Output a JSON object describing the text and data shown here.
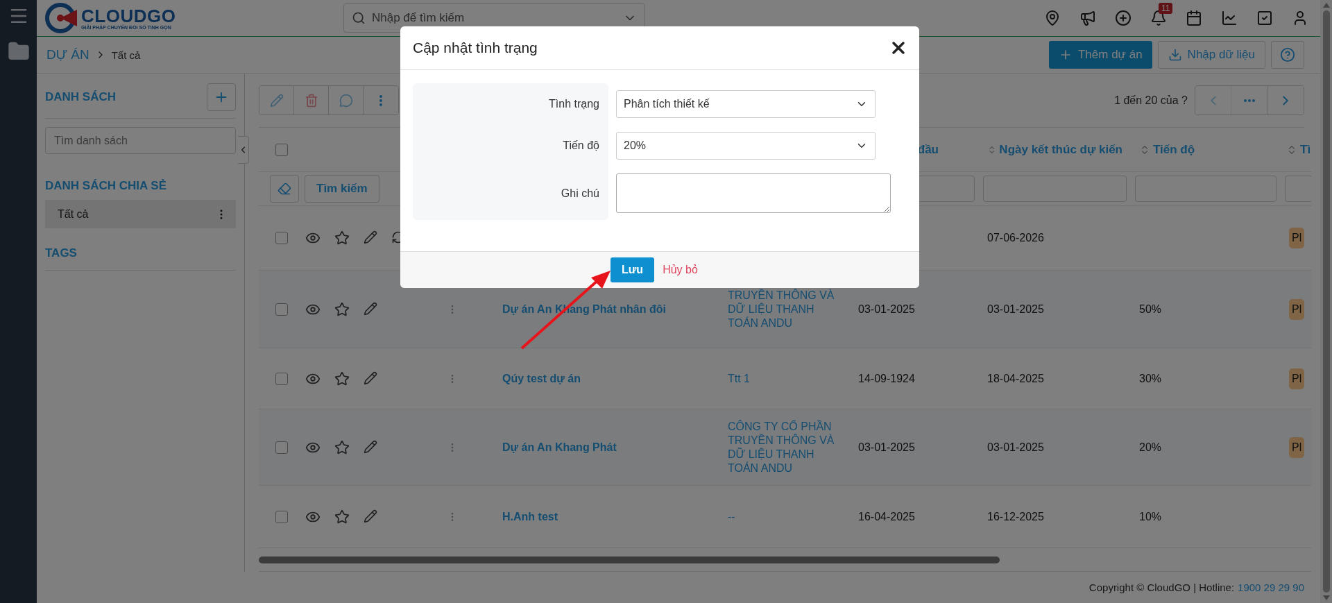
{
  "logo": {
    "name": "CLOUDGO",
    "tagline": "GIẢI PHÁP CHUYỂN ĐỔI SỐ TINH GỌN"
  },
  "search": {
    "placeholder": "Nhập để tìm kiếm"
  },
  "notification_count": "11",
  "breadcrumb": [
    "DỰ ÁN",
    "Tất cả"
  ],
  "actions": [
    "Thêm dự án",
    "Nhập dữ liệu"
  ],
  "lists_panel": {
    "title": "DANH SÁCH",
    "search_placeholder": "Tìm danh sách",
    "shared_title": "DANH SÁCH CHIA SẺ",
    "shared_items": [
      {
        "label": "Tất cả",
        "selected": true
      }
    ],
    "tags_title": "TAGS"
  },
  "pagination": {
    "text": "1 đến 20 của ?",
    "prev_disabled": true
  },
  "filter": {
    "search_button": "Tìm kiếm"
  },
  "table": {
    "select_all_checked": false,
    "columns": [
      {
        "label": "đầu"
      },
      {
        "label": "Ngày kết thúc dự kiến"
      },
      {
        "label": "Tiến độ"
      },
      {
        "label": "Tì"
      }
    ],
    "rows": [
      {
        "checked": false,
        "sync": true,
        "end": "07-06-2026",
        "status": "Pl"
      },
      {
        "checked": false,
        "sync": false,
        "name": "Dự án An Khang Phát nhân đôi",
        "company": "TRUYỀN THÔNG VÀ DỮ LIỆU THANH TOÁN ANDU",
        "start": "03-01-2025",
        "end": "03-01-2025",
        "progress": "50%",
        "status": "Pl"
      },
      {
        "checked": false,
        "sync": false,
        "name": "Qúy test dự án",
        "company": "Ttt 1",
        "start": "14-09-1924",
        "end": "18-04-2025",
        "progress": "30%",
        "status": "Pl"
      },
      {
        "checked": false,
        "sync": false,
        "name": "Dự án An Khang Phát",
        "company": "CÔNG TY CỔ PHẦN TRUYỀN THÔNG VÀ DỮ LIỆU THANH TOÁN ANDU",
        "start": "03-01-2025",
        "end": "03-01-2025",
        "progress": "20%",
        "status": "Pl"
      },
      {
        "checked": false,
        "sync": false,
        "name": "H.Anh test",
        "company": "--",
        "start": "16-04-2025",
        "end": "16-12-2025",
        "progress": "10%"
      }
    ]
  },
  "footer": {
    "copyright": "Copyright © CloudGO | Hotline:",
    "hotline": "1900 29 29 90"
  },
  "modal": {
    "title": "Cập nhật tình trạng",
    "fields": [
      {
        "kind": "select",
        "label": "Tình trạng",
        "value": "Phân tích thiết kế"
      },
      {
        "kind": "select",
        "label": "Tiến độ",
        "value": "20%"
      },
      {
        "kind": "textarea",
        "label": "Ghi chú"
      }
    ],
    "save": "Lưu",
    "cancel": "Hủy bỏ"
  }
}
